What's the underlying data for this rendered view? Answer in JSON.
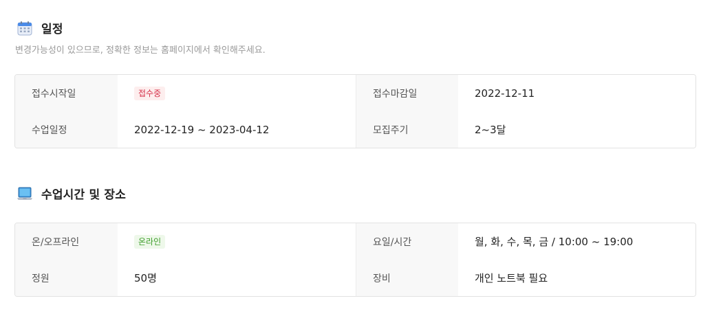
{
  "schedule": {
    "title": "일정",
    "notice": "변경가능성이 있으므로, 정확한 정보는 홈페이지에서 확인해주세요.",
    "rows": [
      {
        "label1": "접수시작일",
        "value1": "접수중",
        "label2": "접수마감일",
        "value2": "2022-12-11"
      },
      {
        "label1": "수업일정",
        "value1": "2022-12-19 ~ 2023-04-12",
        "label2": "모집주기",
        "value2": "2~3달"
      }
    ]
  },
  "location": {
    "title": "수업시간 및 장소",
    "rows": [
      {
        "label1": "온/오프라인",
        "value1": "온라인",
        "label2": "요일/시간",
        "value2": "월, 화, 수, 목, 금 / 10:00 ~ 19:00"
      },
      {
        "label1": "정원",
        "value1": "50명",
        "label2": "장비",
        "value2": "개인 노트북 필요"
      }
    ]
  },
  "colors": {
    "badge_recruiting": "#d6324b",
    "badge_online": "#3f9e2c",
    "label_bg": "#f8f8f8",
    "border": "#e2e2e2"
  },
  "icons": {
    "schedule": "calendar-icon",
    "location": "laptop-icon"
  }
}
